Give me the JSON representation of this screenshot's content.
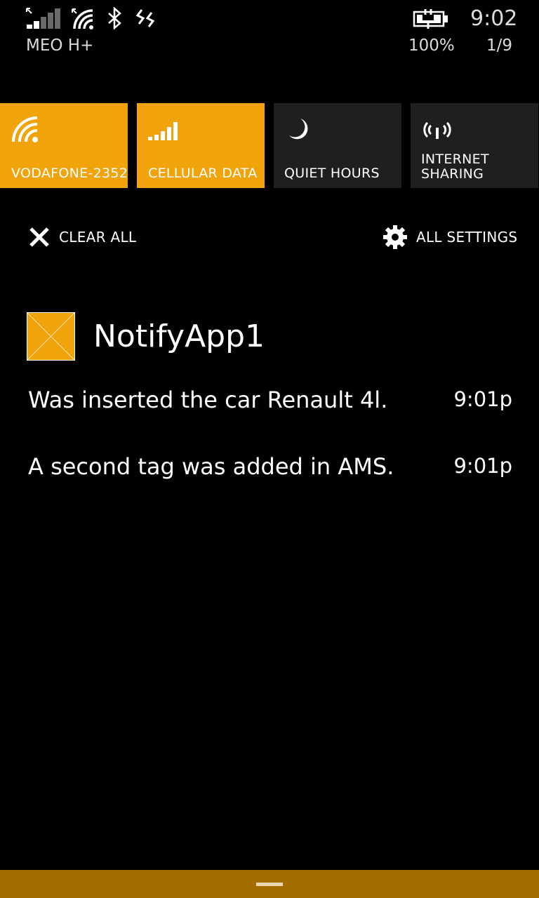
{
  "status_bar": {
    "carrier": "MEO H+",
    "time": "9:02",
    "battery_percent": "100%",
    "notification_count": "1/9",
    "icons": [
      "cell-signal-icon",
      "wifi-icon",
      "bluetooth-icon",
      "vibrate-icon",
      "battery-charging-icon"
    ]
  },
  "quick_actions": [
    {
      "label": "VODAFONE-2352",
      "icon": "wifi-icon",
      "active": true
    },
    {
      "label": "CELLULAR DATA",
      "icon": "cellular-data-icon",
      "active": true
    },
    {
      "label": "QUIET HOURS",
      "icon": "moon-icon",
      "active": false
    },
    {
      "label": "INTERNET\nSHARING",
      "icon": "internet-sharing-icon",
      "active": false
    }
  ],
  "actions": {
    "clear_all": "CLEAR ALL",
    "all_settings": "ALL SETTINGS"
  },
  "notification_group": {
    "app_name": "NotifyApp1",
    "app_icon": "app-placeholder-icon",
    "notifications": [
      {
        "text": "Was inserted the car Renault 4l.",
        "time": "9:01p"
      },
      {
        "text": "A second tag was added in AMS.",
        "time": "9:01p"
      }
    ]
  },
  "colors": {
    "accent": "#f0a30a",
    "tile_inactive": "#1f1f1f",
    "background": "#000000",
    "bottom_bar": "#a16c00"
  }
}
